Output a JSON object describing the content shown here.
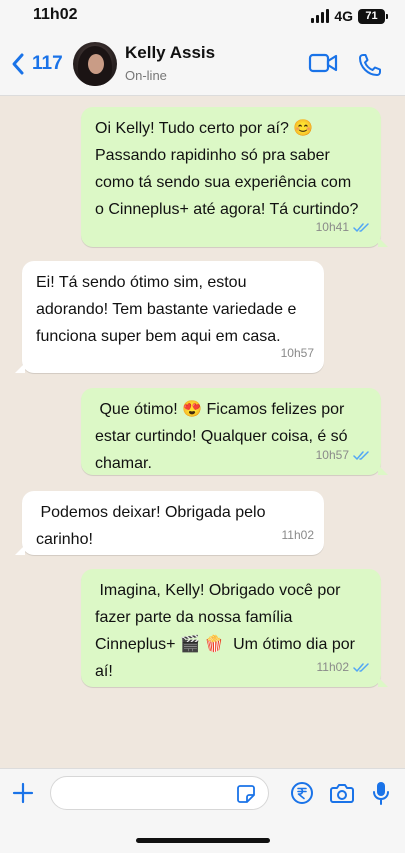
{
  "status_bar": {
    "time": "11h02",
    "network": "4G",
    "battery": "71"
  },
  "header": {
    "back_count": "117",
    "contact_name": "Kelly Assis",
    "contact_status": "On-line"
  },
  "messages": [
    {
      "direction": "out",
      "text": "Oi Kelly! Tudo certo por aí? 😊\nPassando rapidinho só pra saber\ncomo tá sendo sua experiência com\no Cinneplus+ até agora! Tá curtindo?",
      "time": "10h41",
      "read": true
    },
    {
      "direction": "in",
      "text": "Ei! Tá sendo ótimo sim, estou\nadorando! Tem bastante variedade e\nfunciona super bem aqui em casa.",
      "time": "10h57"
    },
    {
      "direction": "out",
      "text": " Que ótimo! 😍 Ficamos felizes por\nestar curtindo! Qualquer coisa, é só\nchamar.",
      "time": "10h57",
      "read": true
    },
    {
      "direction": "in",
      "text": " Podemos deixar! Obrigada pelo\ncarinho!",
      "time": "11h02"
    },
    {
      "direction": "out",
      "text": " Imagina, Kelly! Obrigado você por\nfazer parte da nossa família\nCinneplus+ 🎬 🍿  Um ótimo dia por\naí!",
      "time": "11h02",
      "read": true
    }
  ],
  "composer": {
    "placeholder": ""
  },
  "colors": {
    "accent": "#1a73e8",
    "outgoing_bubble": "#dcf8c6",
    "incoming_bubble": "#ffffff",
    "read_ticks": "#53a6f5",
    "chat_background": "#efe7de"
  },
  "icons": {
    "back": "chevron-left-icon",
    "video": "video-camera-icon",
    "phone": "phone-icon",
    "plus": "plus-icon",
    "sticker": "sticker-icon",
    "payment": "rupee-payment-icon",
    "camera": "camera-icon",
    "mic": "microphone-icon"
  }
}
